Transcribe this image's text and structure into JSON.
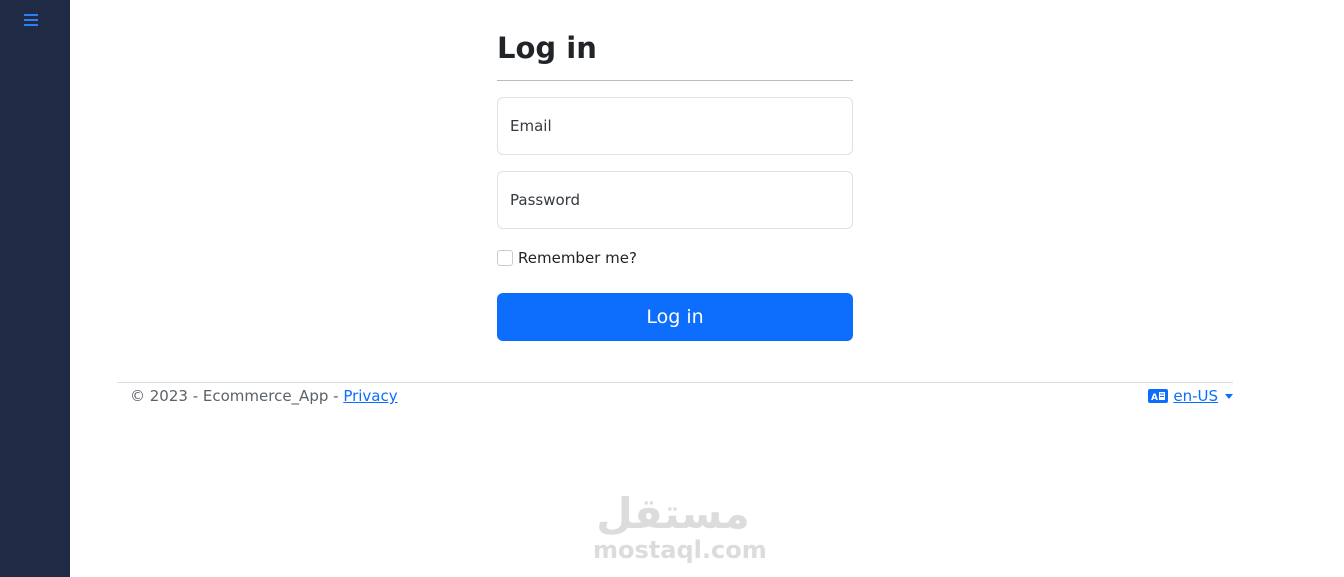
{
  "sidebar": {
    "menu_icon": "hamburger-menu-icon"
  },
  "login": {
    "title": "Log in",
    "email_placeholder": "Email",
    "password_placeholder": "Password",
    "remember_label": "Remember me?",
    "button_label": "Log in"
  },
  "footer": {
    "copyright": "© 2023 - Ecommerce_App - ",
    "privacy_link": "Privacy",
    "language": "en-US",
    "language_icon": "translate-icon"
  },
  "watermark": {
    "arabic": "مستقل",
    "latin": "mostaql.com"
  },
  "colors": {
    "sidebar": "#1f2a44",
    "accent": "#0d6efd",
    "icon": "#2f7df6"
  }
}
